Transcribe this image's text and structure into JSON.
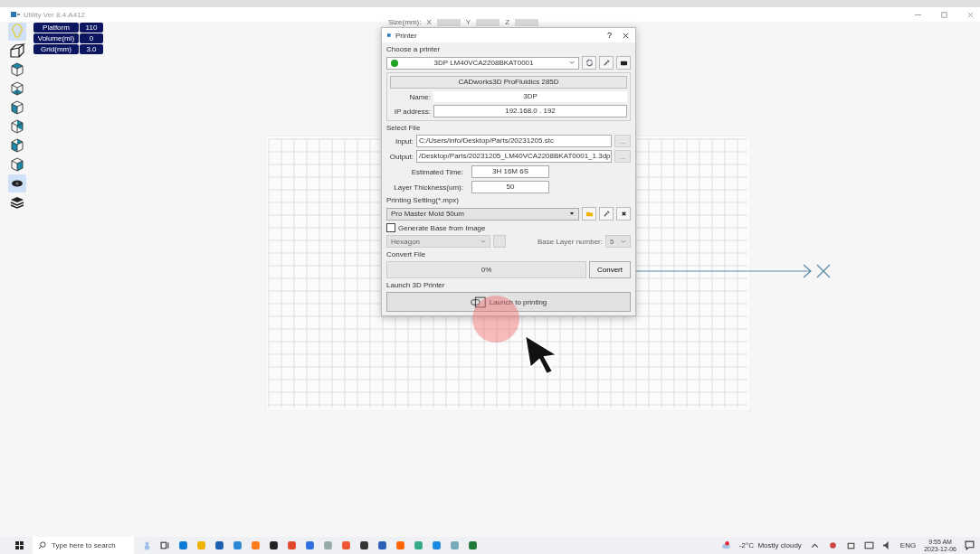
{
  "window": {
    "title": "Utility Ver 8.4.A412"
  },
  "info_panel": [
    {
      "label": "Platform",
      "value": "110"
    },
    {
      "label": "Volume(ml)",
      "value": "0"
    },
    {
      "label": "Grid(mm)",
      "value": "3.0"
    }
  ],
  "toolbar": [
    {
      "kind": "bulb",
      "selected": true
    },
    {
      "kind": "perspective",
      "selected": false
    },
    {
      "kind": "cube-top",
      "selected": false
    },
    {
      "kind": "cube-bottom",
      "selected": false
    },
    {
      "kind": "cube-front",
      "selected": false
    },
    {
      "kind": "cube-back",
      "selected": false
    },
    {
      "kind": "cube-left",
      "selected": false
    },
    {
      "kind": "cube-right",
      "selected": false
    },
    {
      "kind": "eye",
      "selected": true
    },
    {
      "kind": "layers",
      "selected": false
    }
  ],
  "size_bar": {
    "label": "Size(mm):",
    "axes": [
      "X",
      "Y",
      "Z"
    ]
  },
  "dialog": {
    "title": "Printer",
    "help": "?",
    "choose_printer": {
      "heading": "Choose a printer",
      "printer": "3DP LM40VCA2208BKAT0001",
      "connected": true,
      "model": "CADworks3D ProFluidics 285D",
      "name_label": "Name:",
      "name": "3DP",
      "ip_label": "IP address:",
      "ip": "192.168.0 . 192"
    },
    "select_file": {
      "heading": "Select File",
      "input_label": "Input:",
      "input": "C:/Users/info/Desktop/Parts/20231205.stc",
      "input_browse": "...",
      "output_label": "Output:",
      "output": "/Desktop/Parts/20231205_LM40VCA2208BKAT0001_1.3dp",
      "output_browse": "...",
      "time_label": "Estimated Time:",
      "time": "3H 16M 6S",
      "thickness_label": "Layer Thickness(um):",
      "thickness": "50"
    },
    "printing_setting": {
      "heading": "Printing Setting(*.mpx)",
      "value": "Pro Master Mold 50um"
    },
    "generate_base": {
      "label": "Generate Base from Image",
      "checked": false,
      "image": "Hexagon",
      "base_layer_label": "Base Layer number:",
      "base_layer": "5"
    },
    "convert": {
      "heading": "Convert File",
      "progress": "0%",
      "level": 0,
      "button": "Convert"
    },
    "launch": {
      "heading": "Launch 3D Printer",
      "button": "Launch to printing"
    }
  },
  "taskbar": {
    "search_placeholder": "Type here to search",
    "weather": "-2°C  Mostly cloudy",
    "language": "ENG",
    "time": "9:55 AM",
    "date": "2023-12-06"
  }
}
